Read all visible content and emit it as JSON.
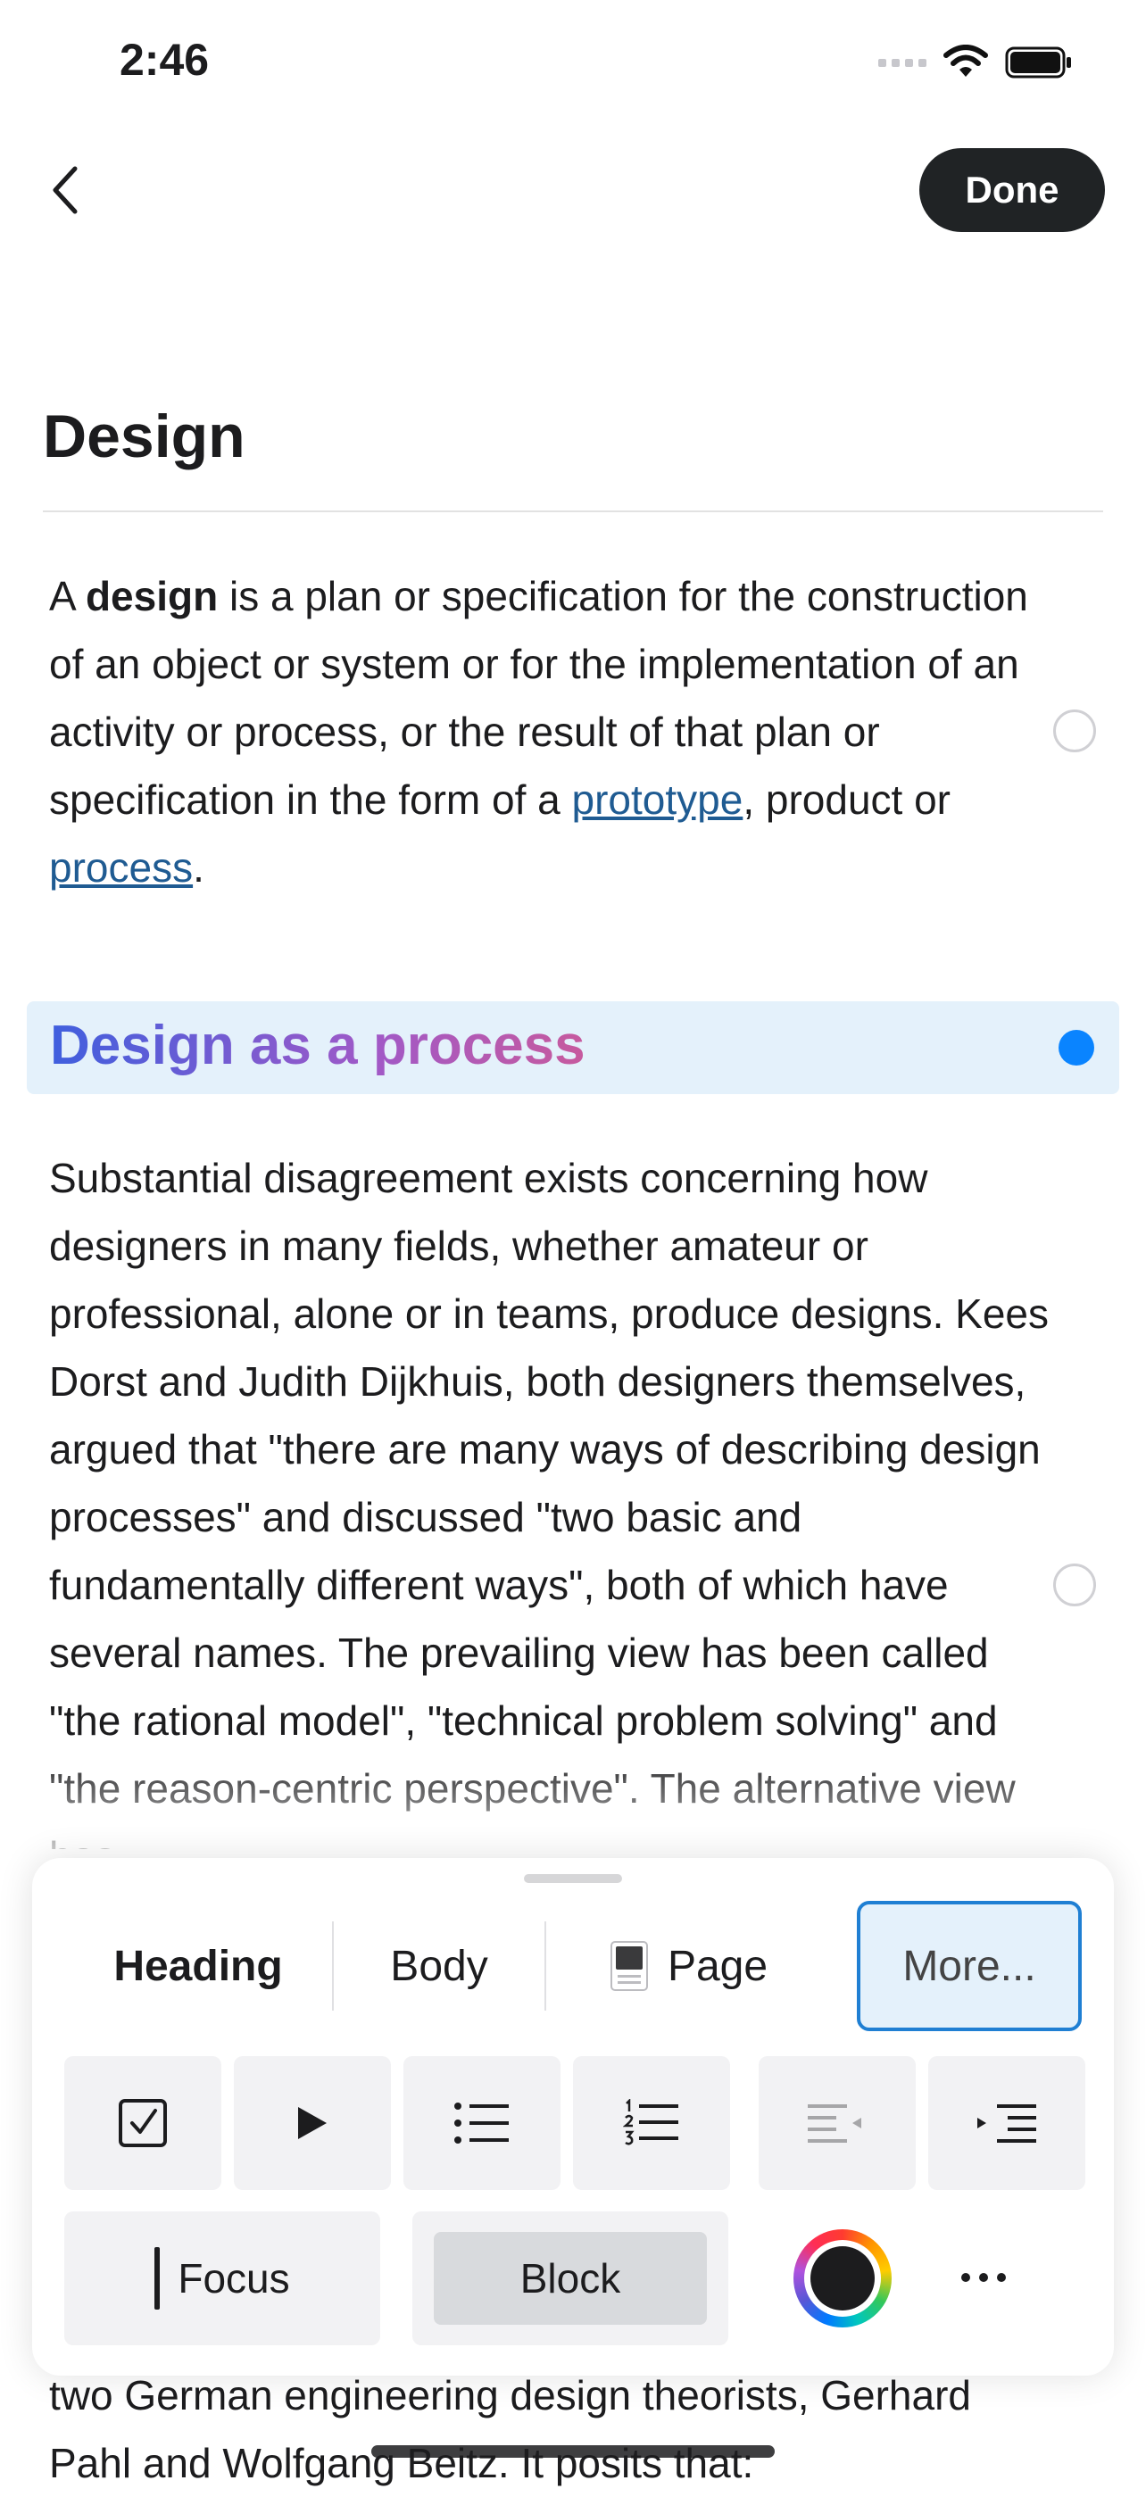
{
  "status_bar": {
    "time": "2:46"
  },
  "nav": {
    "done_label": "Done"
  },
  "document": {
    "title": "Design",
    "intro": {
      "pre": "A ",
      "bold": "design",
      "mid": " is a plan or specification for the construction of an object or system or for the implementation of an activity or process, or the result of that plan or specification in the form of a ",
      "link1": "prototype",
      "between": ", product or ",
      "link2": "process",
      "end": "."
    },
    "section_heading": "Design as a process",
    "section_body": "Substantial disagreement exists concerning how designers in many fields, whether amateur or professional, alone or in teams, produce designs. Kees Dorst and Judith Dijkhuis, both designers themselves, argued that \"there are many ways of describing design processes\" and discussed \"two basic and fundamentally different ways\", both of which have several names. The prevailing view has been called \"the rational model\", \"technical problem solving\" and \"the reason-centric perspective\". The alternative view has",
    "tail_text": "two German engineering design theorists, Gerhard Pahl and Wolfgang Beitz. It posits that:"
  },
  "format_panel": {
    "tabs": {
      "heading": "Heading",
      "body": "Body",
      "page": "Page",
      "more": "More..."
    },
    "focus_label": "Focus",
    "block_label": "Block",
    "icons": [
      "checkbox-icon",
      "toggle-triangle-icon",
      "bulleted-list-icon",
      "numbered-list-icon",
      "outdent-icon",
      "indent-icon",
      "color-picker-icon",
      "more-icon"
    ]
  },
  "colors": {
    "accent": "#0a84ff",
    "done_bg": "#202325",
    "heading_block_bg": "#e4f1fb",
    "link": "#1f5b92"
  }
}
